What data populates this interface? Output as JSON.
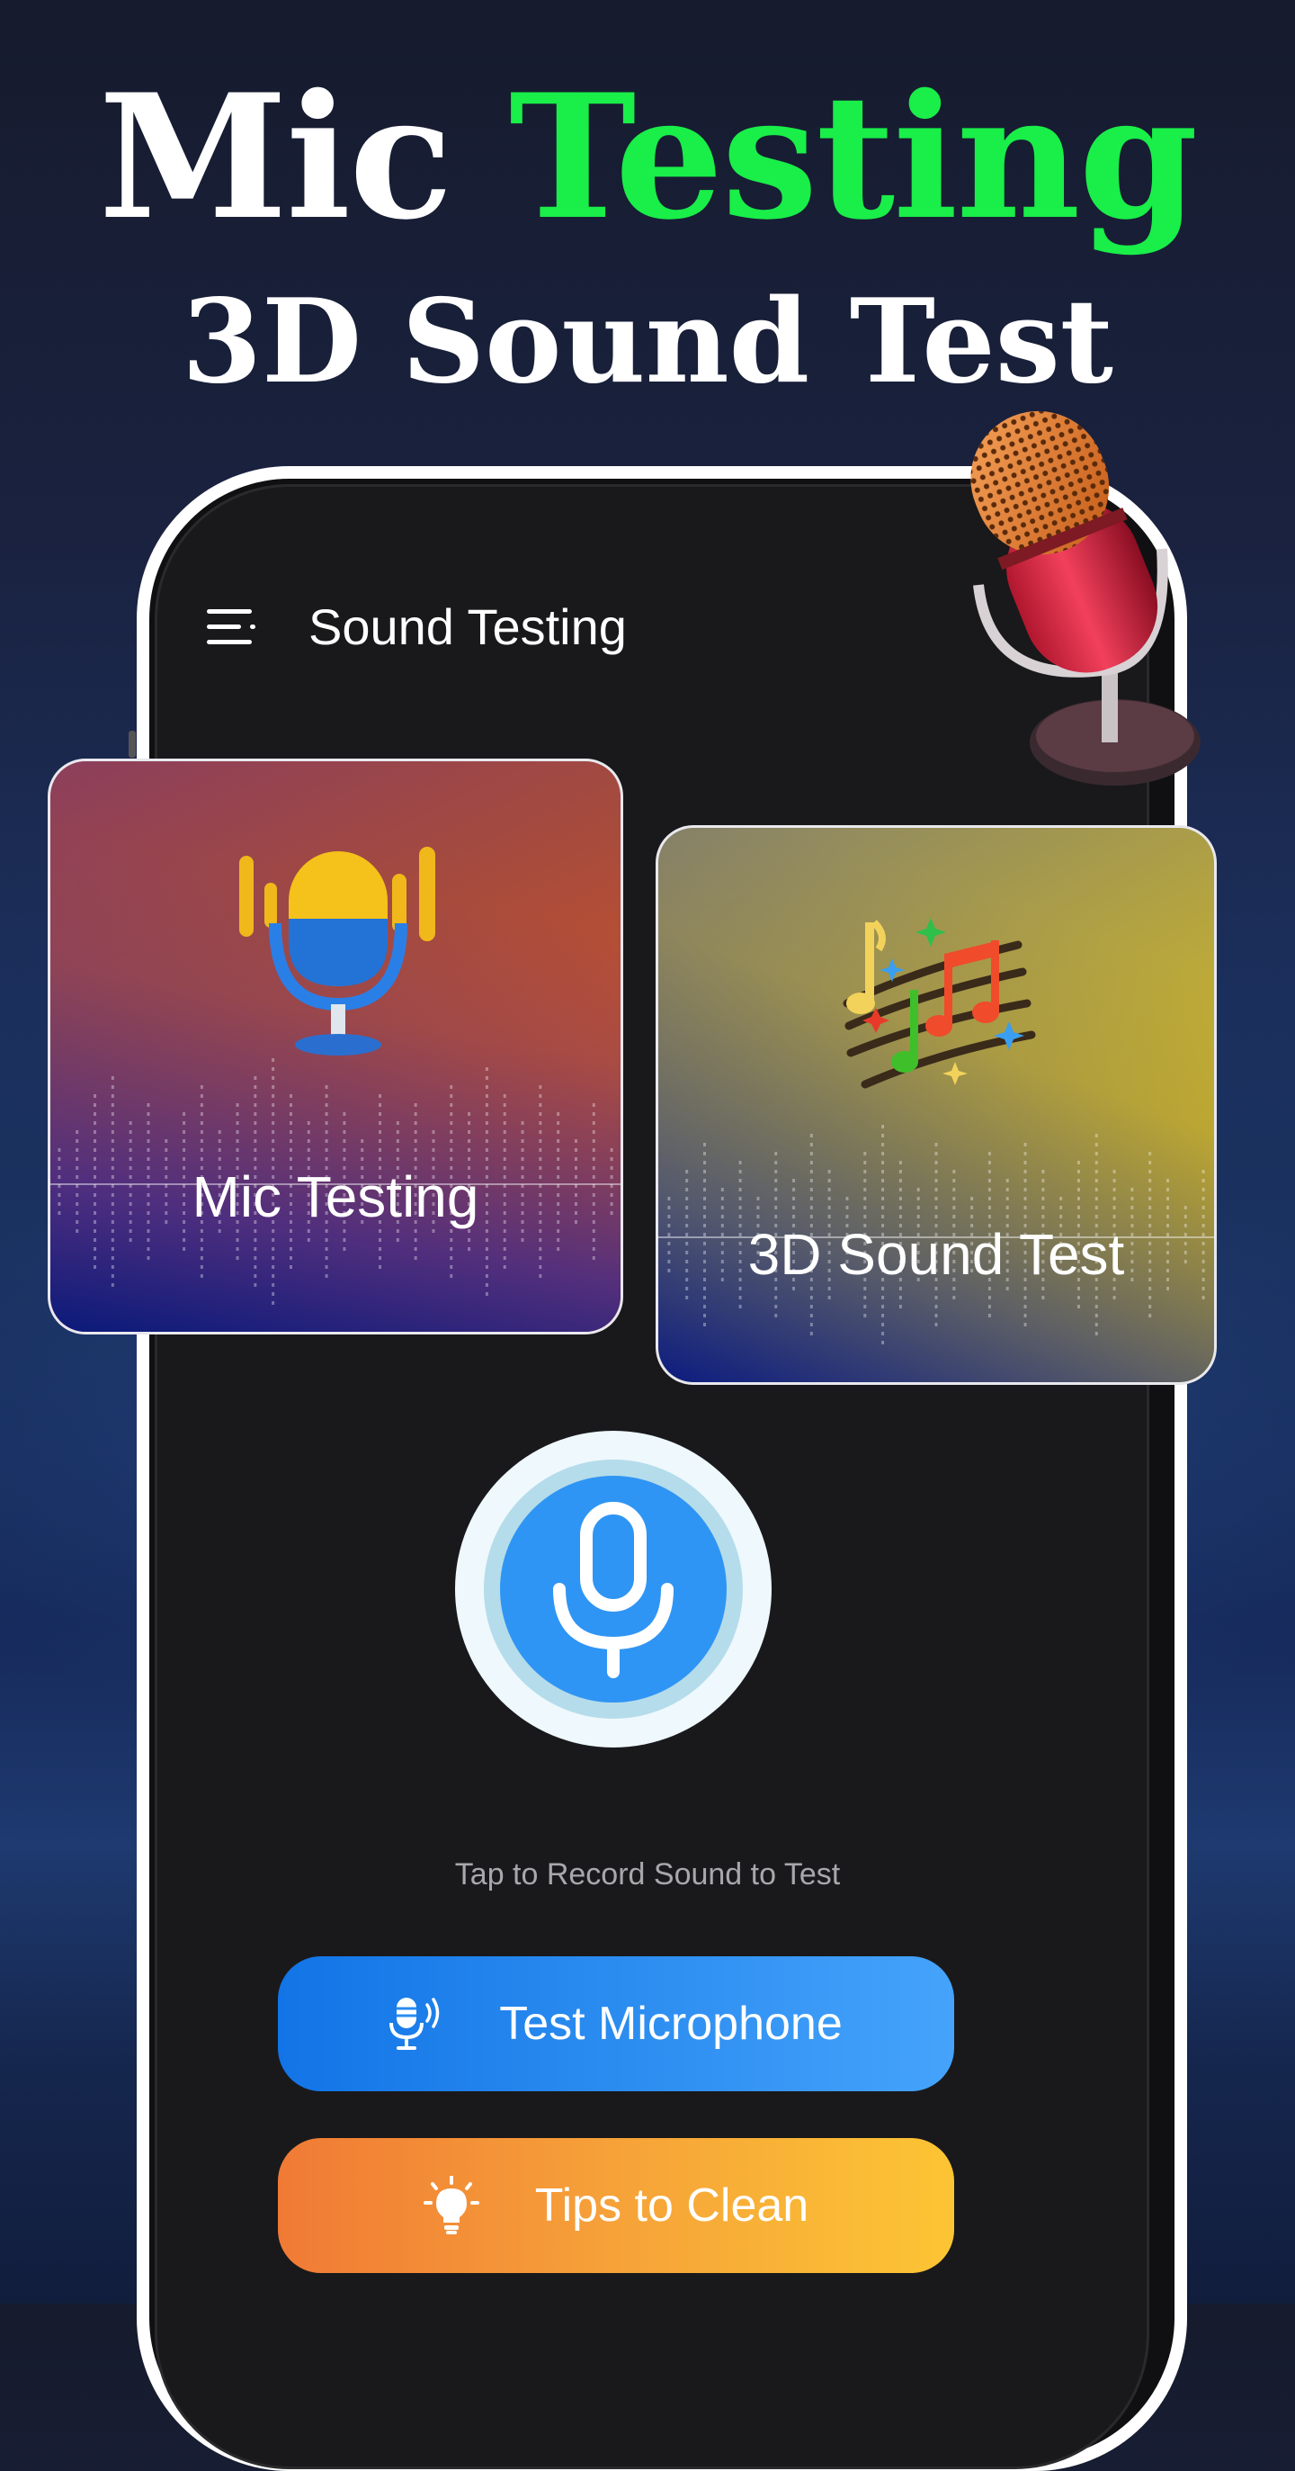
{
  "headline": {
    "part1": "Mic ",
    "part2": "Testing",
    "subtitle": "3D Sound Test"
  },
  "app": {
    "title": "Sound Testing"
  },
  "cards": [
    {
      "label": "Mic Testing"
    },
    {
      "label": "3D Sound Test"
    }
  ],
  "record": {
    "hint": "Tap to Record Sound to Test"
  },
  "buttons": {
    "test_microphone": "Test Microphone",
    "tips_to_clean": "Tips to Clean"
  },
  "colors": {
    "accent_green": "#19ee49",
    "primary_blue": "#2f95f4",
    "orange_start": "#f07a35",
    "yellow_end": "#fcc534"
  },
  "icons": [
    "menu-icon",
    "microphone-icon",
    "music-notes-icon",
    "mic-speaking-icon",
    "lightbulb-icon"
  ]
}
